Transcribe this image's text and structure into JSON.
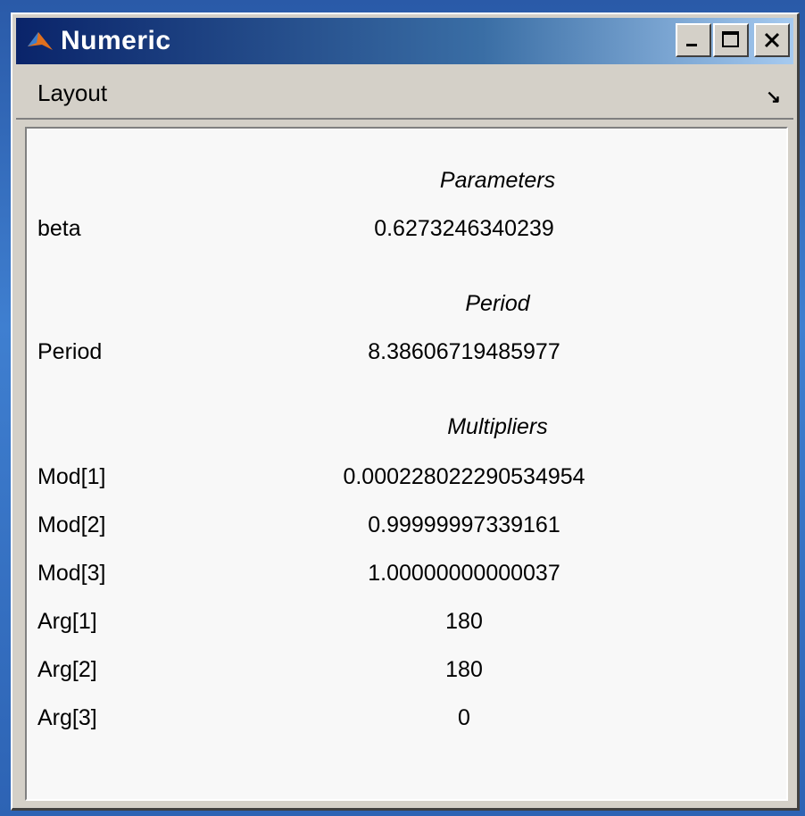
{
  "window": {
    "title": "Numeric",
    "app_icon": "matlab-icon",
    "buttons": {
      "minimize": "_",
      "maximize": "□",
      "close": "X"
    }
  },
  "menubar": {
    "items": [
      {
        "label": "Layout"
      }
    ],
    "arrow": "↘"
  },
  "sections": {
    "parameters": {
      "title": "Parameters",
      "rows": [
        {
          "label": "beta",
          "value": "0.6273246340239"
        }
      ]
    },
    "period": {
      "title": "Period",
      "rows": [
        {
          "label": "Period",
          "value": "8.38606719485977"
        }
      ]
    },
    "multipliers": {
      "title": "Multipliers",
      "rows": [
        {
          "label": "Mod[1]",
          "value": "0.000228022290534954"
        },
        {
          "label": "Mod[2]",
          "value": "0.99999997339161"
        },
        {
          "label": "Mod[3]",
          "value": "1.00000000000037"
        },
        {
          "label": "Arg[1]",
          "value": "180"
        },
        {
          "label": "Arg[2]",
          "value": "180"
        },
        {
          "label": "Arg[3]",
          "value": "0"
        }
      ]
    }
  }
}
